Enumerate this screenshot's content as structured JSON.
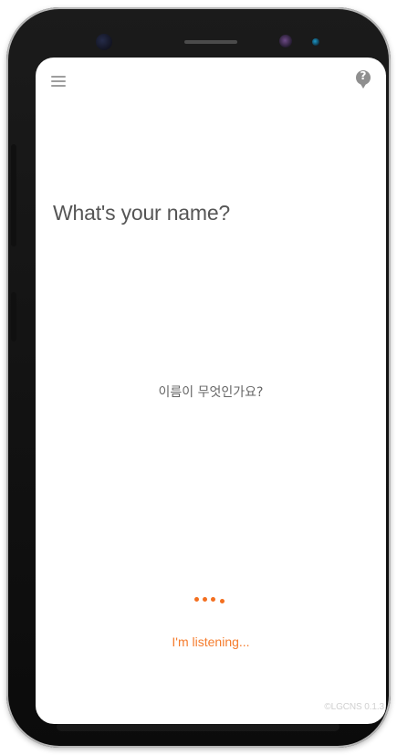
{
  "screen": {
    "title": "What's your name?",
    "translation": "이름이 무엇인가요?",
    "status": "I'm listening...",
    "version": "©LGCNS 0.1.3"
  },
  "icons": {
    "menu": "menu-icon",
    "help": "help-icon",
    "listening": "listening-dots-icon"
  },
  "colors": {
    "accent": "#f57c2d",
    "text_primary": "#555555",
    "text_secondary": "#666666",
    "icon_gray": "#9e9e9e"
  }
}
